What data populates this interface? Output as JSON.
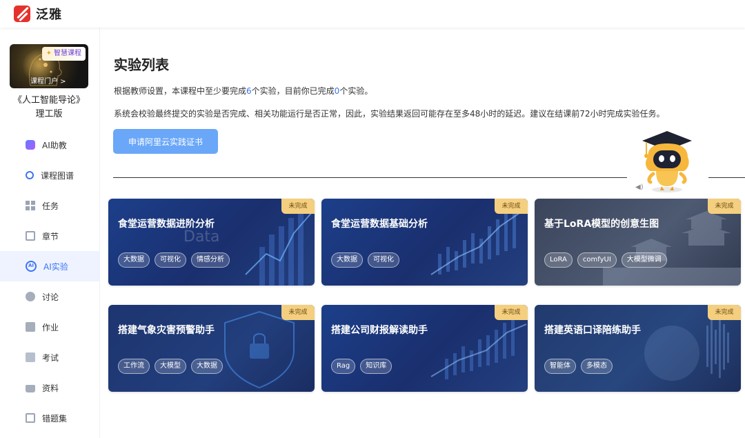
{
  "app": {
    "name": "泛雅"
  },
  "sidebar": {
    "cover": {
      "badge": "智慧课程",
      "link": "课程门户 >"
    },
    "course_title_line1": "《人工智能导论》",
    "course_title_line2": "理工版",
    "items": [
      {
        "label": "AI助教",
        "icon": "ai-assistant-icon",
        "active": false
      },
      {
        "label": "课程图谱",
        "icon": "knowledge-graph-icon",
        "active": false
      },
      {
        "label": "任务",
        "icon": "grid-icon",
        "active": false
      },
      {
        "label": "章节",
        "icon": "book-icon",
        "active": false
      },
      {
        "label": "AI实验",
        "icon": "ai-lab-icon",
        "active": true
      },
      {
        "label": "讨论",
        "icon": "chat-icon",
        "active": false
      },
      {
        "label": "作业",
        "icon": "pen-icon",
        "active": false
      },
      {
        "label": "考试",
        "icon": "exam-icon",
        "active": false
      },
      {
        "label": "资料",
        "icon": "folder-icon",
        "active": false
      },
      {
        "label": "错题集",
        "icon": "mistakes-icon",
        "active": false
      }
    ]
  },
  "main": {
    "title": "实验列表",
    "desc1": {
      "pre": "根据教师设置，本课程中至少要完成",
      "required": "6",
      "mid": "个实验，目前你已完成",
      "done": "0",
      "post": "个实验。"
    },
    "desc2": "系统会校验最终提交的实验是否完成、相关功能运行是否正常，因此，实验结果返回可能存在至多48小时的延迟。建议在结课前72小时完成实验任务。",
    "cert_button": "申请阿里云实践证书",
    "sound_icon": "speaker-icon",
    "cards": [
      {
        "title": "食堂运营数据进阶分析",
        "status": "未完成",
        "tags": [
          "大数据",
          "可视化",
          "情感分析"
        ],
        "watermark": "Data"
      },
      {
        "title": "食堂运营数据基础分析",
        "status": "未完成",
        "tags": [
          "大数据",
          "可视化"
        ]
      },
      {
        "title": "基于LoRA模型的创意生图",
        "status": "未完成",
        "tags": [
          "LoRA",
          "comfyUI",
          "大模型微调"
        ]
      },
      {
        "title": "搭建气象灾害预警助手",
        "status": "未完成",
        "tags": [
          "工作流",
          "大模型",
          "大数据"
        ]
      },
      {
        "title": "搭建公司财报解读助手",
        "status": "未完成",
        "tags": [
          "Rag",
          "知识库"
        ]
      },
      {
        "title": "搭建英语口译陪练助手",
        "status": "未完成",
        "tags": [
          "智能体",
          "多模态"
        ]
      }
    ]
  },
  "colors": {
    "accent": "#3b73f5",
    "button": "#6aa7f8",
    "status_badge": "#f4cf7f"
  }
}
